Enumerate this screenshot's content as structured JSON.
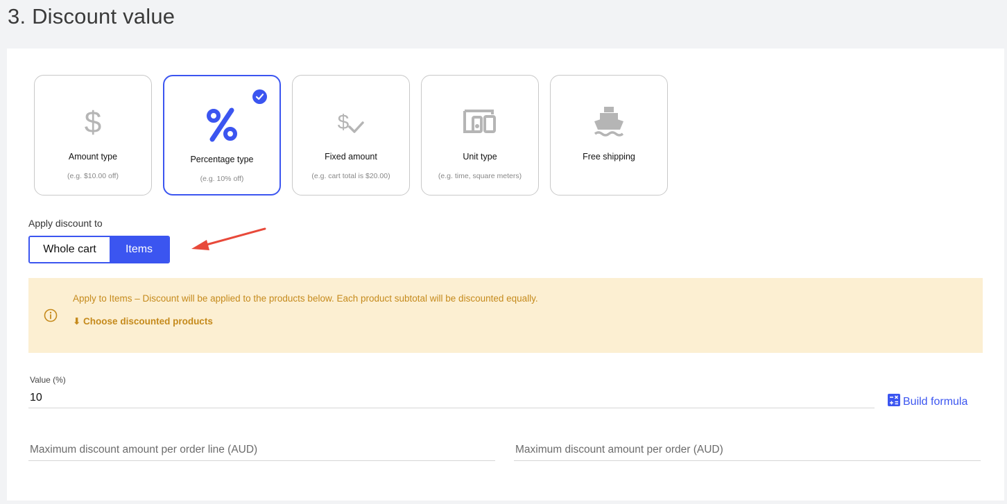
{
  "page": {
    "title": "3. Discount value"
  },
  "discount_types": [
    {
      "title": "Amount type",
      "hint": "(e.g. $10.00 off)",
      "icon": "dollar-icon",
      "selected": false
    },
    {
      "title": "Percentage type",
      "hint": "(e.g. 10% off)",
      "icon": "percent-icon",
      "selected": true
    },
    {
      "title": "Fixed amount",
      "hint": "(e.g. cart total is $20.00)",
      "icon": "dollar-check-icon",
      "selected": false
    },
    {
      "title": "Unit type",
      "hint": "(e.g. time, square meters)",
      "icon": "devices-icon",
      "selected": false
    },
    {
      "title": "Free shipping",
      "hint": "",
      "icon": "ship-icon",
      "selected": false
    }
  ],
  "apply": {
    "label": "Apply discount to",
    "options": [
      "Whole cart",
      "Items"
    ],
    "selected": "Items"
  },
  "notice": {
    "text": "Apply to Items – Discount will be applied to the products below. Each product subtotal will be discounted equally.",
    "link": "⬇ Choose discounted products"
  },
  "value": {
    "label": "Value (%)",
    "value": "10"
  },
  "formula": {
    "label": "Build formula"
  },
  "max_line": {
    "placeholder": "Maximum discount amount per order line (AUD)"
  },
  "max_order": {
    "placeholder": "Maximum discount amount per order (AUD)"
  },
  "colors": {
    "accent": "#3b55f0",
    "notice_bg": "#fcefd2",
    "notice_text": "#c58a1c",
    "annotation_arrow": "#e8493a",
    "icon_inactive": "#b5b5b5"
  }
}
